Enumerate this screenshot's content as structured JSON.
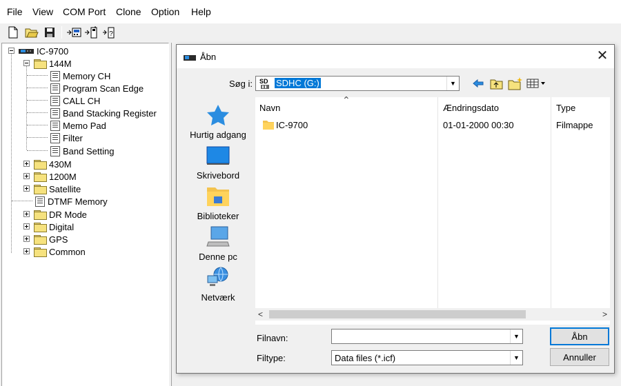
{
  "menu": [
    "File",
    "View",
    "COM Port",
    "Clone",
    "Option",
    "Help"
  ],
  "toolbar": {
    "icons": [
      "new-file-icon",
      "open-folder-icon",
      "save-disk-icon",
      "read-from-radio-icon",
      "write-to-radio-icon",
      "radio-info-icon"
    ]
  },
  "tree": {
    "root": "IC-9700",
    "band_144": "144M",
    "children_144": [
      "Memory CH",
      "Program Scan Edge",
      "CALL CH",
      "Band Stacking Register",
      "Memo Pad",
      "Filter",
      "Band Setting"
    ],
    "rest": [
      {
        "label": "430M",
        "type": "folder"
      },
      {
        "label": "1200M",
        "type": "folder"
      },
      {
        "label": "Satellite",
        "type": "folder"
      },
      {
        "label": "DTMF Memory",
        "type": "doc"
      },
      {
        "label": "DR Mode",
        "type": "folder"
      },
      {
        "label": "Digital",
        "type": "folder"
      },
      {
        "label": "GPS",
        "type": "folder"
      },
      {
        "label": "Common",
        "type": "folder"
      }
    ]
  },
  "dialog": {
    "title": "Åbn",
    "close": "✕",
    "look_in_label": "Søg i:",
    "look_in_value": "SDHC (G:)",
    "places": [
      "Hurtig adgang",
      "Skrivebord",
      "Biblioteker",
      "Denne pc",
      "Netværk"
    ],
    "columns": [
      "Navn",
      "Ændringsdato",
      "Type"
    ],
    "files": [
      {
        "name": "IC-9700",
        "date": "01-01-2000 00:30",
        "type": "Filmappe"
      }
    ],
    "filename_label": "Filnavn:",
    "filename_value": "",
    "filetype_label": "Filtype:",
    "filetype_value": "Data files (*.icf)",
    "open_button": "Åbn",
    "cancel_button": "Annuller",
    "sd_label": "SD"
  },
  "colors": {
    "selection": "#0078d7",
    "accent_blue": "#2b8de0"
  }
}
